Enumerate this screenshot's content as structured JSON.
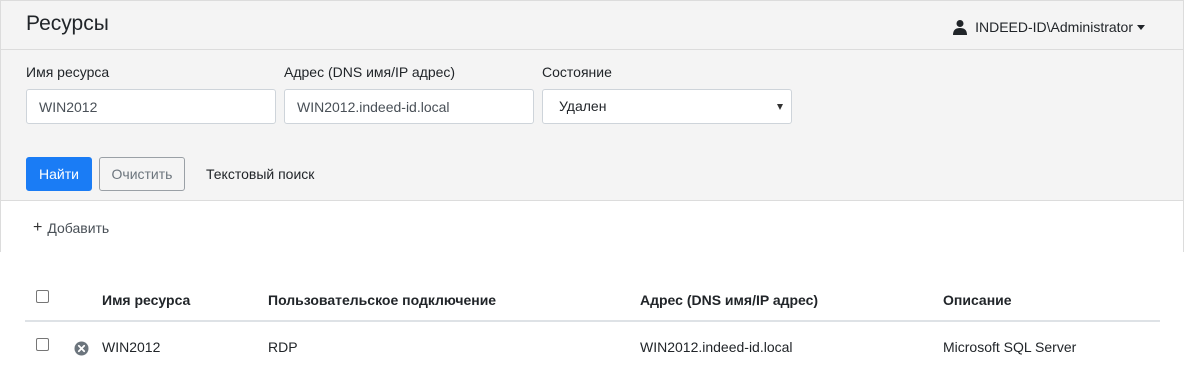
{
  "header": {
    "title": "Ресурсы",
    "user": {
      "name": "INDEED-ID\\Administrator",
      "icon": "user-icon"
    }
  },
  "filters": {
    "resource_name": {
      "label": "Имя ресурса",
      "value": "WIN2012"
    },
    "address": {
      "label": "Адрес (DNS имя/IP адрес)",
      "value": "WIN2012.indeed-id.local"
    },
    "state": {
      "label": "Состояние",
      "value": "Удален"
    }
  },
  "actions": {
    "find": "Найти",
    "clear": "Очистить",
    "text_search": "Текстовый поиск"
  },
  "toolbar": {
    "add": "Добавить",
    "add_icon": "+"
  },
  "table": {
    "headers": [
      "Имя ресурса",
      "Пользовательское подключение",
      "Адрес (DNS имя/IP адрес)",
      "Описание"
    ],
    "rows": [
      {
        "name": "WIN2012",
        "connection": "RDP",
        "address": "WIN2012.indeed-id.local",
        "description": "Microsoft SQL Server",
        "status_icon": "remove-circle-icon"
      }
    ]
  },
  "colors": {
    "primary": "#1a7cf5",
    "panel_bg": "#f4f4f4",
    "border": "#dcdcdc"
  }
}
